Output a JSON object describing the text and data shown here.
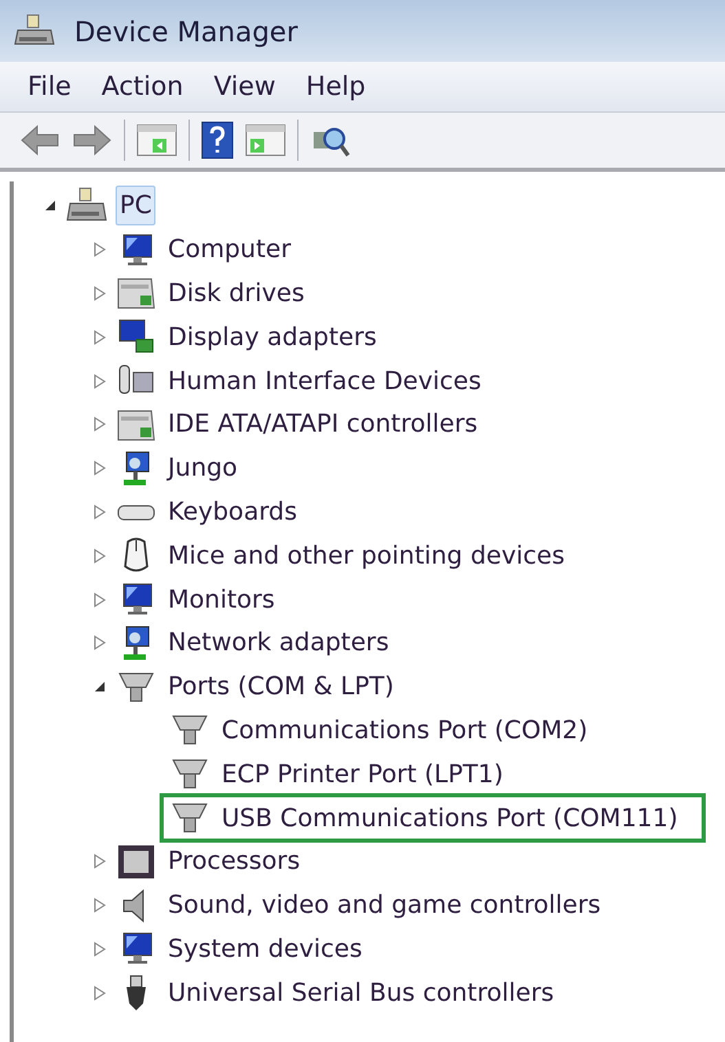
{
  "window": {
    "title": "Device Manager"
  },
  "menu": [
    "File",
    "Action",
    "View",
    "Help"
  ],
  "tree": [
    {
      "label": "PC",
      "kind": "pc",
      "selected": true,
      "expanded": true,
      "children": [
        {
          "label": "Computer",
          "kind": "computer",
          "expanded": false
        },
        {
          "label": "Disk drives",
          "kind": "disk",
          "expanded": false
        },
        {
          "label": "Display adapters",
          "kind": "display",
          "expanded": false
        },
        {
          "label": "Human Interface Devices",
          "kind": "hid",
          "expanded": false
        },
        {
          "label": "IDE ATA/ATAPI controllers",
          "kind": "disk",
          "expanded": false
        },
        {
          "label": "Jungo",
          "kind": "network",
          "expanded": false
        },
        {
          "label": "Keyboards",
          "kind": "keyboard",
          "expanded": false
        },
        {
          "label": "Mice and other pointing devices",
          "kind": "mouse",
          "expanded": false
        },
        {
          "label": "Monitors",
          "kind": "computer",
          "expanded": false
        },
        {
          "label": "Network adapters",
          "kind": "network",
          "expanded": false
        },
        {
          "label": "Ports (COM & LPT)",
          "kind": "port",
          "expanded": true,
          "children": [
            {
              "label": "Communications Port (COM2)",
              "kind": "port",
              "highlighted": false
            },
            {
              "label": "ECP Printer Port (LPT1)",
              "kind": "port",
              "highlighted": false
            },
            {
              "label": "USB Communications Port (COM111)",
              "kind": "port",
              "highlighted": true
            }
          ]
        },
        {
          "label": "Processors",
          "kind": "processor",
          "expanded": false
        },
        {
          "label": "Sound, video and game controllers",
          "kind": "sound",
          "expanded": false
        },
        {
          "label": "System devices",
          "kind": "computer",
          "expanded": false
        },
        {
          "label": "Universal Serial Bus controllers",
          "kind": "usb",
          "expanded": false
        }
      ]
    }
  ]
}
